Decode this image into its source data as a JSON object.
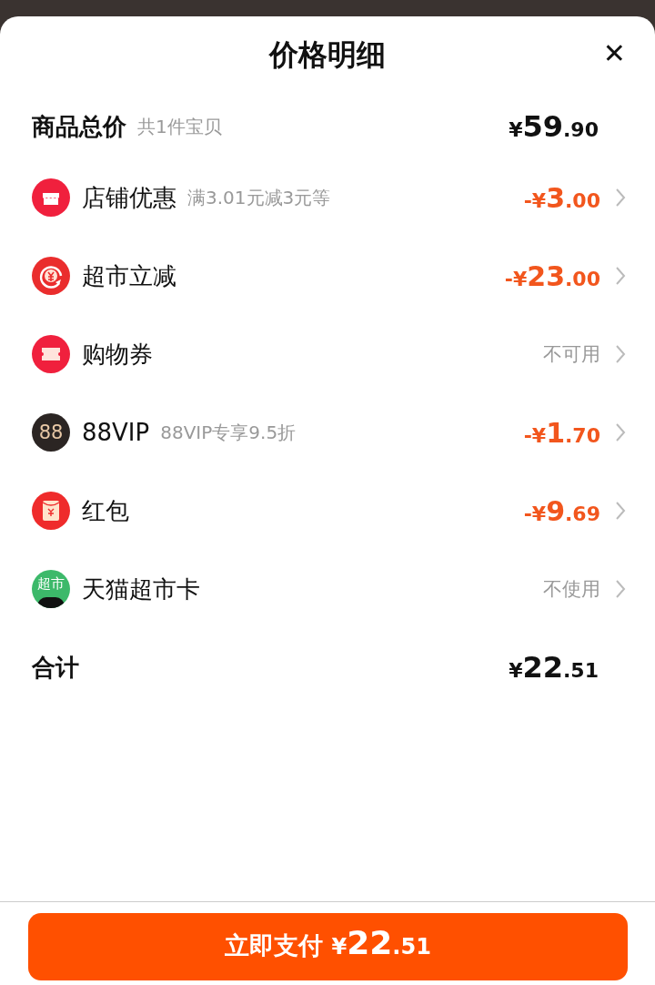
{
  "sheet": {
    "title": "价格明细",
    "close": "✕"
  },
  "subtotal": {
    "label": "商品总价",
    "note": "共1件宝贝",
    "price": "¥59.90"
  },
  "rows": [
    {
      "label": "店铺优惠",
      "note": "满3.01元减3元等",
      "kind": "amount",
      "value": "-¥3.00"
    },
    {
      "label": "超市立减",
      "kind": "amount",
      "value": "-¥23.00"
    },
    {
      "label": "购物券",
      "kind": "status",
      "value": "不可用"
    },
    {
      "label": "88VIP",
      "note": "88VIP专享9.5折",
      "kind": "amount",
      "value": "-¥1.70",
      "icon_text": "88"
    },
    {
      "label": "红包",
      "kind": "amount",
      "value": "-¥9.69"
    },
    {
      "label": "天猫超市卡",
      "kind": "status",
      "value": "不使用",
      "icon_text": "超市"
    }
  ],
  "total": {
    "label": "合计",
    "price": "¥22.51"
  },
  "pay_button": {
    "label": "立即支付",
    "price": "¥22.51"
  }
}
